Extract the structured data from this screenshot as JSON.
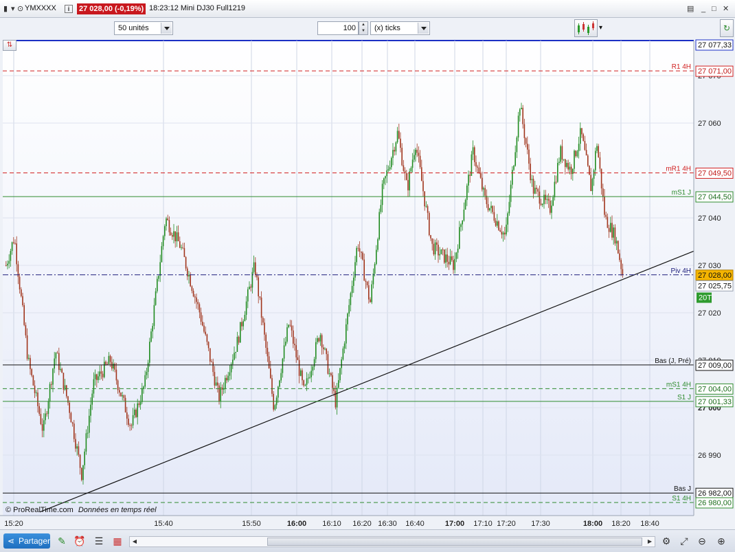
{
  "window": {
    "symbol": "YMXXXX",
    "price_badge": "27 028,00 (-0,19%)",
    "time_and_name": "18:23:12  Mini DJ30 Full1219"
  },
  "toolbar": {
    "units_select": "50 unités",
    "ticks_value": "100",
    "ticks_select": "(x) ticks"
  },
  "chart": {
    "watermark": "© ProRealTime.com",
    "realtime_label": "Données en temps réel",
    "price_axis_ticks": [
      "27 070",
      "27 060",
      "27 040",
      "27 030",
      "27 020",
      "27 010",
      "27 000",
      "26 990"
    ],
    "time_axis_labels": [
      {
        "label": "15:20",
        "bold": false
      },
      {
        "label": "15:40",
        "bold": false
      },
      {
        "label": "15:50",
        "bold": false
      },
      {
        "label": "16:00",
        "bold": true
      },
      {
        "label": "16:10",
        "bold": false
      },
      {
        "label": "16:20",
        "bold": false
      },
      {
        "label": "16:30",
        "bold": false
      },
      {
        "label": "16:40",
        "bold": false
      },
      {
        "label": "17:00",
        "bold": true
      },
      {
        "label": "17:10",
        "bold": false
      },
      {
        "label": "17:20",
        "bold": false
      },
      {
        "label": "17:30",
        "bold": false
      },
      {
        "label": "18:00",
        "bold": true
      },
      {
        "label": "18:20",
        "bold": false
      },
      {
        "label": "18:40",
        "bold": false
      }
    ],
    "level_lines": [
      {
        "name": "R1 4H",
        "price": "27 071,00",
        "color": "#d12020",
        "style": "dashed"
      },
      {
        "name": "mR1 4H",
        "price": "27 049,50",
        "color": "#d12020",
        "style": "dashed"
      },
      {
        "name": "mS1 J",
        "price": "27 044,50",
        "color": "#2e8b2e",
        "style": "solid"
      },
      {
        "name": "Piv 4H",
        "price": "27 028,00",
        "color": "#1a1a7a",
        "style": "dashdot"
      },
      {
        "name": "Bas (J, Pré)",
        "price": "27 009,00",
        "color": "#111111",
        "style": "solid"
      },
      {
        "name": "mS1 4H",
        "price": "27 004,00",
        "color": "#2e8b2e",
        "style": "dashed"
      },
      {
        "name": "S1 J",
        "price": "27 001,33",
        "color": "#2e8b2e",
        "style": "solid"
      },
      {
        "name": "Bas J",
        "price": "26 982,00",
        "color": "#111111",
        "style": "solid"
      },
      {
        "name": "S1 4H",
        "price": "26 980,00",
        "color": "#2e8b2e",
        "style": "dashed"
      }
    ],
    "top_price_label": "27 077,33",
    "current_price_label": "27 028,00",
    "bid_price_label": "27 025,75",
    "countdown_label": "20T",
    "bull_color": "#1f8a1f",
    "bear_color": "#a0341b"
  },
  "bottombar": {
    "share_label": "Partager"
  }
}
